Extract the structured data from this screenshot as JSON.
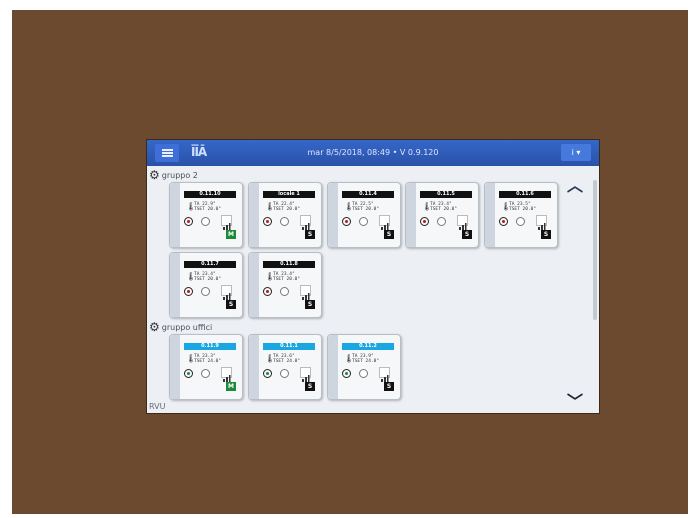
{
  "header": {
    "datetime": "mar 8/5/2018, 08:49 • V 0.9.120",
    "info_label": "i ▾"
  },
  "groups": [
    {
      "label": "gruppo 2",
      "cards": [
        {
          "name": "0.11.10",
          "ta": "TA  22.9°",
          "tset": "TSET 20.0°",
          "mode": "M"
        },
        {
          "name": "locale 1",
          "ta": "TA  22.4°",
          "tset": "TSET 20.0°",
          "mode": "S"
        },
        {
          "name": "0.11.4",
          "ta": "TA  22.5°",
          "tset": "TSET 20.0°",
          "mode": "S"
        },
        {
          "name": "0.11.5",
          "ta": "TA  23.4°",
          "tset": "TSET 20.0°",
          "mode": "S"
        },
        {
          "name": "0.11.6",
          "ta": "TA  23.5°",
          "tset": "TSET 20.0°",
          "mode": "S"
        },
        {
          "name": "0.11.7",
          "ta": "TA  23.4°",
          "tset": "TSET 20.0°",
          "mode": "S"
        },
        {
          "name": "0.11.8",
          "ta": "TA  23.4°",
          "tset": "TSET 20.0°",
          "mode": "S"
        }
      ]
    },
    {
      "label": "gruppo uffici",
      "cards": [
        {
          "name": "0.11.9",
          "ta": "TA  23.3°",
          "tset": "TSET 24.0°",
          "mode": "M"
        },
        {
          "name": "0.11.1",
          "ta": "TA  23.6°",
          "tset": "TSET 24.0°",
          "mode": "S"
        },
        {
          "name": "0.11.2",
          "ta": "TA  23.9°",
          "tset": "TSET 24.0°",
          "mode": "S"
        }
      ]
    }
  ],
  "footer": "RVU",
  "colors": {
    "header_dark": "#111111",
    "header_cyan": "#1aa6e0",
    "badge_green": "#1d8a3a",
    "badge_black": "#111111",
    "btn_red": "#c4161c",
    "btn_green": "#1d8a3a"
  }
}
